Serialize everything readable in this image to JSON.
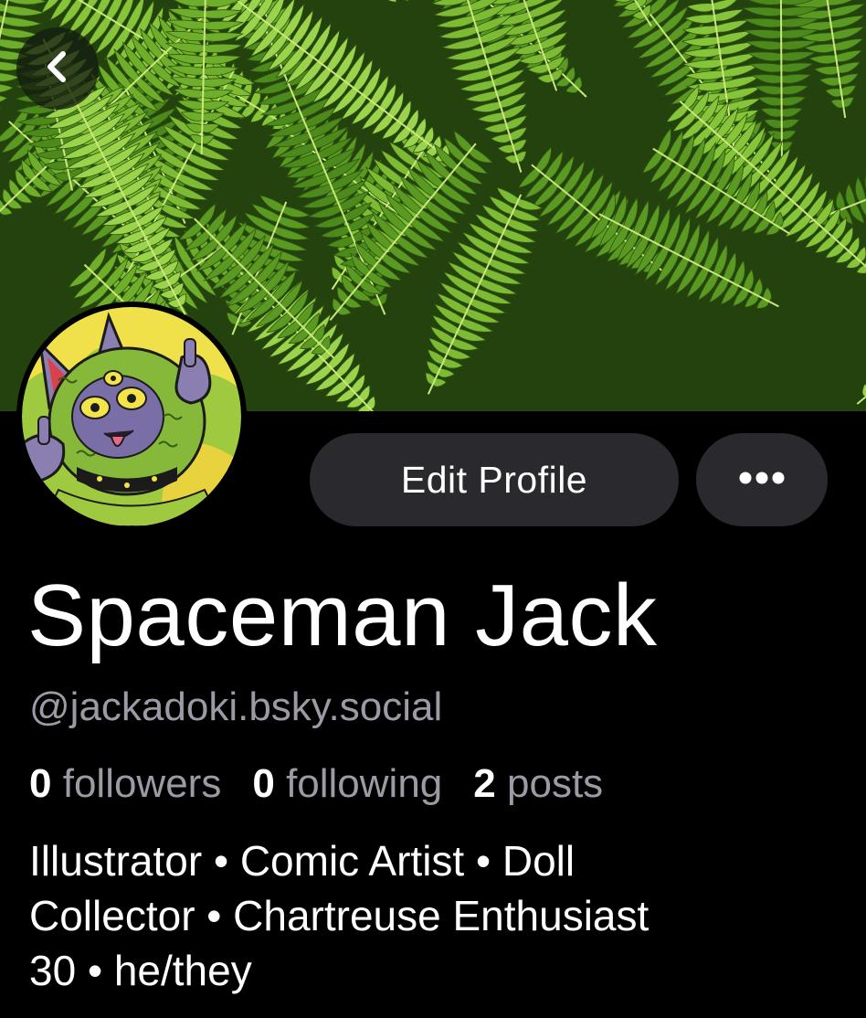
{
  "banner": {
    "image": "fern-foliage-banner"
  },
  "nav": {
    "back_icon": "chevron-left-icon"
  },
  "avatar": {
    "image": "illustrated-green-creature-avatar"
  },
  "actions": {
    "edit_label": "Edit Profile",
    "more_icon": "ellipsis-icon"
  },
  "profile": {
    "display_name": "Spaceman Jack",
    "handle": "@jackadoki.bsky.social",
    "stats": [
      {
        "count": "0",
        "label": "followers"
      },
      {
        "count": "0",
        "label": "following"
      },
      {
        "count": "2",
        "label": "posts"
      }
    ],
    "bio_lines": [
      "Illustrator • Comic Artist • Doll",
      "Collector • Chartreuse Enthusiast",
      "30 • he/they"
    ]
  },
  "colors": {
    "background": "#000000",
    "button_bg": "#2a2a2e",
    "secondary_text": "#9b9ba6",
    "primary_text": "#ffffff"
  }
}
